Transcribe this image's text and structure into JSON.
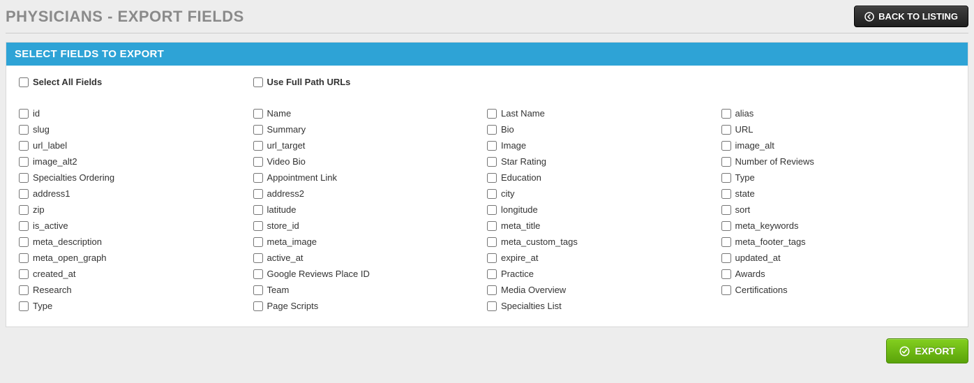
{
  "header": {
    "title": "PHYSICIANS - EXPORT FIELDS",
    "back_label": "BACK TO LISTING"
  },
  "panel": {
    "title": "SELECT FIELDS TO EXPORT",
    "select_all_label": "Select All Fields",
    "full_path_label": "Use Full Path URLs"
  },
  "fields": [
    "id",
    "Name",
    "Last Name",
    "alias",
    "slug",
    "Summary",
    "Bio",
    "URL",
    "url_label",
    "url_target",
    "Image",
    "image_alt",
    "image_alt2",
    "Video Bio",
    "Star Rating",
    "Number of Reviews",
    "Specialties Ordering",
    "Appointment Link",
    "Education",
    "Type",
    "address1",
    "address2",
    "city",
    "state",
    "zip",
    "latitude",
    "longitude",
    "sort",
    "is_active",
    "store_id",
    "meta_title",
    "meta_keywords",
    "meta_description",
    "meta_image",
    "meta_custom_tags",
    "meta_footer_tags",
    "meta_open_graph",
    "active_at",
    "expire_at",
    "updated_at",
    "created_at",
    "Google Reviews Place ID",
    "Practice",
    "Awards",
    "Research",
    "Team",
    "Media Overview",
    "Certifications",
    "Type",
    "Page Scripts",
    "Specialties List"
  ],
  "footer": {
    "export_label": "EXPORT"
  }
}
